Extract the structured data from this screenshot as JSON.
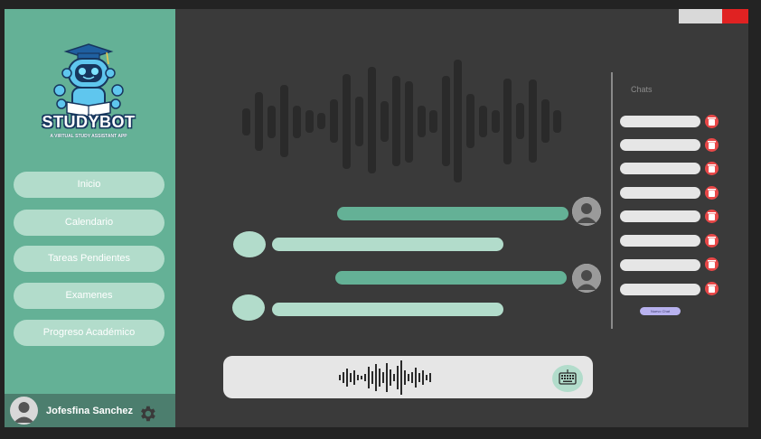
{
  "app": {
    "logo_title": "STUDYBOT",
    "logo_subtitle": "A VIRTUAL STUDY ASSISTANT APP"
  },
  "sidebar": {
    "items": [
      {
        "label": "Inicio"
      },
      {
        "label": "Calendario"
      },
      {
        "label": "Tareas Pendientes"
      },
      {
        "label": "Examenes"
      },
      {
        "label": "Progreso Académico"
      }
    ],
    "user_name": "Jofesfina Sanchez"
  },
  "chats": {
    "title": "Chats",
    "items": [
      "",
      "",
      "",
      "",
      "",
      "",
      "",
      ""
    ],
    "new_chat_label": "Nuevo Chat"
  },
  "icons": {
    "settings": "gear-icon",
    "delete": "trash-icon",
    "keyboard": "keyboard-icon",
    "voice": "waveform-icon",
    "user": "user-avatar-icon"
  },
  "colors": {
    "accent": "#64b196",
    "accent_light": "#b2dccb",
    "danger": "#e84848",
    "new_chat": "#b8b2ef"
  }
}
